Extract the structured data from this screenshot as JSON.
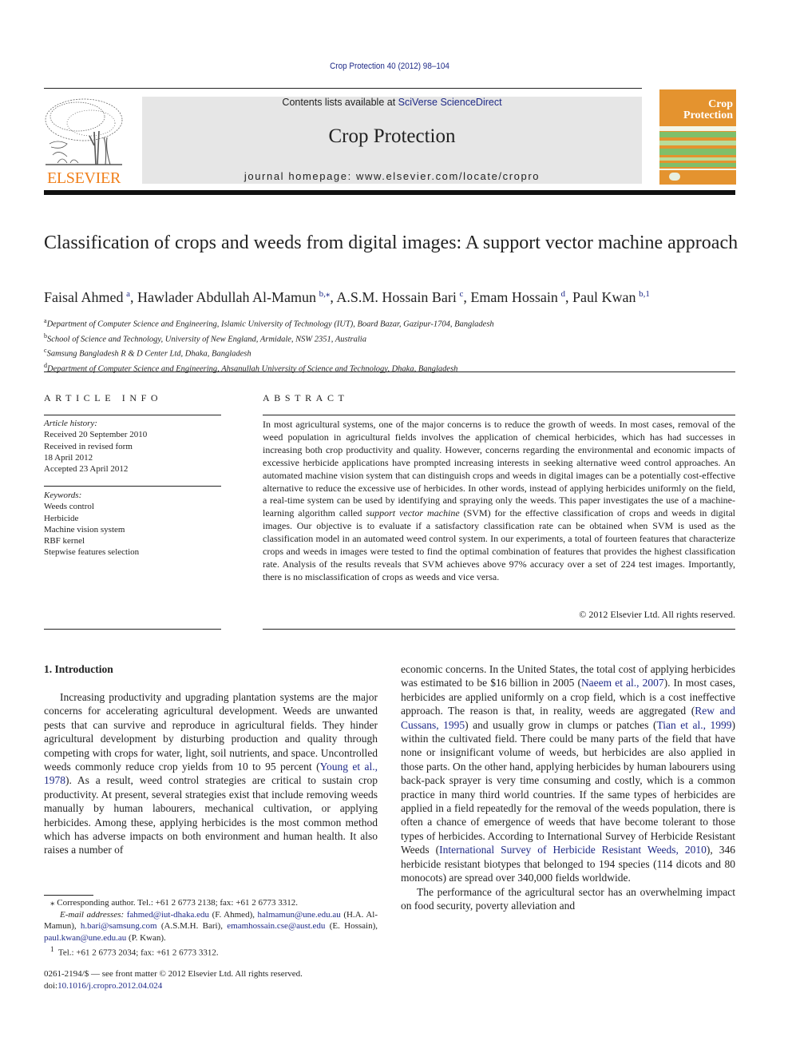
{
  "header": {
    "citation": "Crop Protection 40 (2012) 98–104",
    "contents_prefix": "Contents lists available at ",
    "contents_link": "SciVerse ScienceDirect",
    "journal_title": "Crop Protection",
    "homepage_label": "journal homepage: ",
    "homepage_url": "www.elsevier.com/locate/cropro",
    "publisher_logo_text": "ELSEVIER",
    "cover_title_line1": "Crop",
    "cover_title_line2": "Protection"
  },
  "colors": {
    "link": "#1f2a87",
    "elsevier_orange": "#f07f1a",
    "cover_orange": "#e4932f",
    "cover_green": "#7fbf6a",
    "banner_gray": "#e6e6e6"
  },
  "article": {
    "title": "Classification of crops and weeds from digital images: A support vector machine approach",
    "authors": [
      {
        "name": "Faisal Ahmed",
        "sup": "a"
      },
      {
        "name": "Hawlader Abdullah Al-Mamun",
        "sup": "b,⁎"
      },
      {
        "name": "A.S.M. Hossain Bari",
        "sup": "c"
      },
      {
        "name": "Emam Hossain",
        "sup": "d"
      },
      {
        "name": "Paul Kwan",
        "sup": "b,1"
      }
    ],
    "affiliations": [
      {
        "key": "a",
        "text": "Department of Computer Science and Engineering, Islamic University of Technology (IUT), Board Bazar, Gazipur-1704, Bangladesh"
      },
      {
        "key": "b",
        "text": "School of Science and Technology, University of New England, Armidale, NSW 2351, Australia"
      },
      {
        "key": "c",
        "text": "Samsung Bangladesh R & D Center Ltd, Dhaka, Bangladesh"
      },
      {
        "key": "d",
        "text": "Department of Computer Science and Engineering, Ahsanullah University of Science and Technology, Dhaka, Bangladesh"
      }
    ]
  },
  "article_info": {
    "heading": "ARTICLE INFO",
    "history_label": "Article history:",
    "history": [
      "Received 20 September 2010",
      "Received in revised form",
      "18 April 2012",
      "Accepted 23 April 2012"
    ],
    "keywords_label": "Keywords:",
    "keywords": [
      "Weeds control",
      "Herbicide",
      "Machine vision system",
      "RBF kernel",
      "Stepwise features selection"
    ]
  },
  "abstract": {
    "heading": "ABSTRACT",
    "part1": "In most agricultural systems, one of the major concerns is to reduce the growth of weeds. In most cases, removal of the weed population in agricultural fields involves the application of chemical herbicides, which has had successes in increasing both crop productivity and quality. However, concerns regarding the environmental and economic impacts of excessive herbicide applications have prompted increasing interests in seeking alternative weed control approaches. An automated machine vision system that can distinguish crops and weeds in digital images can be a potentially cost-effective alternative to reduce the excessive use of herbicides. In other words, instead of applying herbicides uniformly on the field, a real-time system can be used by identifying and spraying only the weeds. This paper investigates the use of a machine-learning algorithm called ",
    "italic": "support vector machine",
    "part2": " (SVM) for the effective classification of crops and weeds in digital images. Our objective is to evaluate if a satisfactory classification rate can be obtained when SVM is used as the classification model in an automated weed control system. In our experiments, a total of fourteen features that characterize crops and weeds in images were tested to find the optimal combination of features that provides the highest classification rate. Analysis of the results reveals that SVM achieves above 97% accuracy over a set of 224 test images. Importantly, there is no misclassification of crops as weeds and vice versa.",
    "copyright": "© 2012 Elsevier Ltd. All rights reserved."
  },
  "introduction": {
    "heading": "1.  Introduction",
    "col1_p1_a": "Increasing productivity and upgrading plantation systems are the major concerns for accelerating agricultural development. Weeds are unwanted pests that can survive and reproduce in agricultural fields. They hinder agricultural development by disturbing production and quality through competing with crops for water, light, soil nutrients, and space. Uncontrolled weeds commonly reduce crop yields from 10 to 95 percent (",
    "col1_ref1": "Young et al., 1978",
    "col1_p1_b": "). As a result, weed control strategies are critical to sustain crop productivity. At present, several strategies exist that include removing weeds manually by human labourers, mechanical cultivation, or applying herbicides. Among these, applying herbicides is the most common method which has adverse impacts on both environment and human health. It also raises a number of",
    "col2_p1_a": "economic concerns. In the United States, the total cost of applying herbicides was estimated to be $16 billion in 2005 (",
    "col2_ref1": "Naeem et al., 2007",
    "col2_p1_b": "). In most cases, herbicides are applied uniformly on a crop field, which is a cost ineffective approach. The reason is that, in reality, weeds are aggregated (",
    "col2_ref2": "Rew and Cussans, 1995",
    "col2_p1_c": ") and usually grow in clumps or patches (",
    "col2_ref3": "Tian et al., 1999",
    "col2_p1_d": ") within the cultivated field. There could be many parts of the field that have none or insignificant volume of weeds, but herbicides are also applied in those parts. On the other hand, applying herbicides by human labourers using back-pack sprayer is very time consuming and costly, which is a common practice in many third world countries. If the same types of herbicides are applied in a field repeatedly for the removal of the weeds population, there is often a chance of emergence of weeds that have become tolerant to those types of herbicides. According to International Survey of Herbicide Resistant Weeds (",
    "col2_ref4": "International Survey of Herbicide Resistant Weeds, 2010",
    "col2_p1_e": "), 346 herbicide resistant biotypes that belonged to 194 species (114 dicots and 80 monocots) are spread over 340,000 fields worldwide.",
    "col2_p2": "The performance of the agricultural sector has an overwhelming impact on food security, poverty alleviation and"
  },
  "footnotes": {
    "corresponding": "⁎  Corresponding author. Tel.: +61 2 6773 2138; fax: +61 2 6773 3312.",
    "email_label": "E-mail addresses:",
    "emails": [
      {
        "addr": "fahmed@iut-dhaka.edu",
        "who": " (F. Ahmed), "
      },
      {
        "addr": "halmamun@une.edu.au",
        "who": " (H.A. Al-Mamun), "
      },
      {
        "addr": "h.bari@samsung.com",
        "who": " (A.S.M.H. Bari), "
      },
      {
        "addr": "emamhossain.cse@aust.edu",
        "who": " (E. Hossain), "
      },
      {
        "addr": "paul.kwan@une.edu.au",
        "who": " (P. Kwan)."
      }
    ],
    "note1": "Tel.: +61 2 6773 2034; fax: +61 2 6773 3312.",
    "note1_mark": "1"
  },
  "front_matter": {
    "issn_line": "0261-2194/$ — see front matter © 2012 Elsevier Ltd. All rights reserved.",
    "doi_label": "doi:",
    "doi": "10.1016/j.cropro.2012.04.024"
  }
}
